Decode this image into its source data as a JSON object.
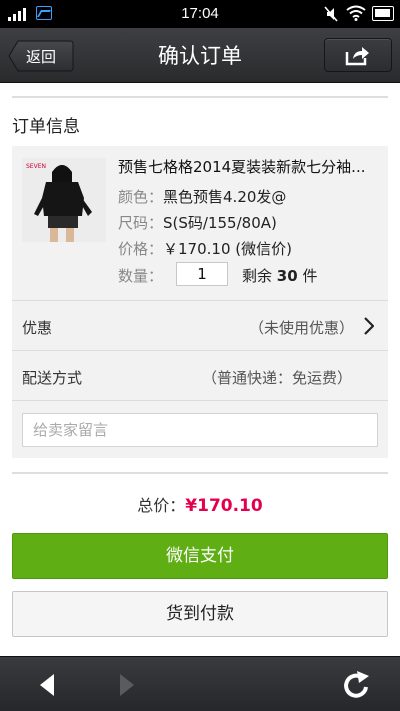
{
  "status_bar": {
    "time": "17:04"
  },
  "header": {
    "back_label": "返回",
    "title": "确认订单"
  },
  "order": {
    "section_title": "订单信息",
    "product": {
      "name": "预售七格格2014夏装装新款七分袖...",
      "color_label": "颜色：",
      "color_value": "黑色预售4.20发@",
      "size_label": "尺码：",
      "size_value": "S(S码/155/80A)",
      "price_label": "价格：",
      "price_value": "￥170.10 (微信价)",
      "quantity_label": "数量：",
      "quantity_value": "1",
      "remaining_prefix": "剩余",
      "remaining_count": "30",
      "remaining_suffix": "件"
    },
    "discount_label": "优惠",
    "discount_value": "（未使用优惠）",
    "delivery_label": "配送方式",
    "delivery_value": "（普通快递：免运费）",
    "message_placeholder": "给卖家留言"
  },
  "summary": {
    "total_label": "总价：",
    "total_value": "¥170.10"
  },
  "actions": {
    "wechat_pay_label": "微信支付",
    "cod_label": "货到付款"
  },
  "colors": {
    "accent_green": "#5fae14",
    "price_red": "#e5004f",
    "bar_dark": "#2c2d30"
  }
}
